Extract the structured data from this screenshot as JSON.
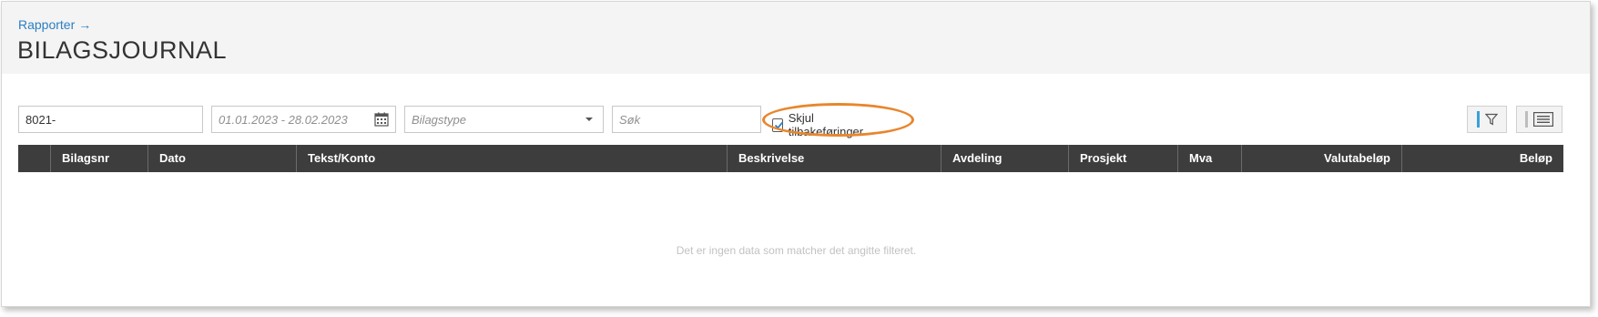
{
  "breadcrumb": {
    "label": "Rapporter",
    "arrow": "→"
  },
  "title": "BILAGSJOURNAL",
  "filters": {
    "account_value": "8021-",
    "date_range": "01.01.2023 - 28.02.2023",
    "voucher_type_placeholder": "Bilagstype",
    "search_placeholder": "Søk",
    "hide_reversals_label": "Skjul tilbakeføringer",
    "hide_reversals_checked": true
  },
  "toolbar": {
    "filter_icon": "funnel-icon",
    "view_icon": "list-view-icon"
  },
  "table": {
    "columns": [
      "Bilagsnr",
      "Dato",
      "Tekst/Konto",
      "Beskrivelse",
      "Avdeling",
      "Prosjekt",
      "Mva",
      "Valutabeløp",
      "Beløp"
    ],
    "rows": [],
    "empty_message": "Det er ingen data som matcher det angitte filteret."
  },
  "colors": {
    "accent_link": "#2b7fc1",
    "header_bg": "#3d3d3d",
    "highlight": "#e8862d",
    "filter_active": "#3aa0dc"
  }
}
